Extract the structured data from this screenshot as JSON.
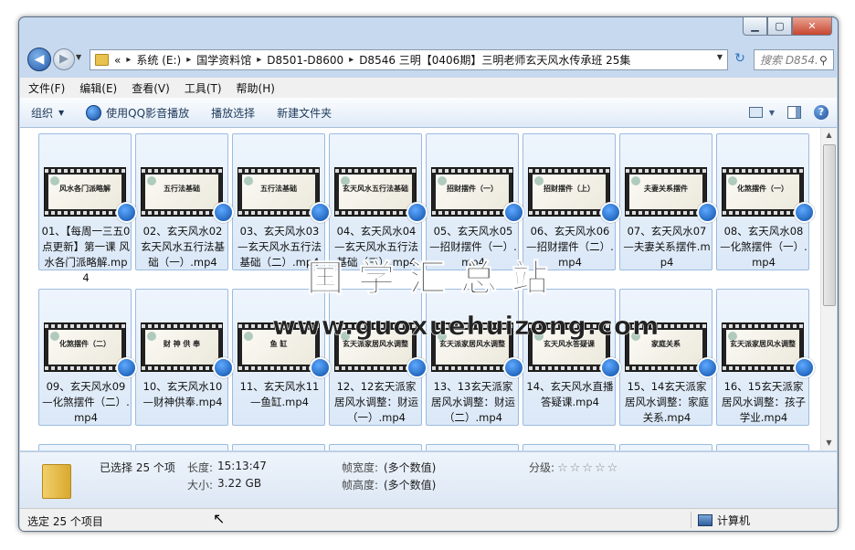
{
  "window": {
    "controls": {
      "minimize": "▁",
      "maximize": "▢",
      "close": "✕"
    }
  },
  "nav": {
    "address_parts": [
      "«",
      "系统 (E:)",
      "国学资料馆",
      "D8501-D8600",
      "D8546 三明【0406期】三明老师玄天风水传承班 25集"
    ],
    "search_placeholder": "搜索 D854...",
    "back_glyph": "◀",
    "forward_glyph": "▶",
    "refresh_glyph": "↻",
    "search_glyph": "⚲"
  },
  "menubar": {
    "items": [
      "文件(F)",
      "编辑(E)",
      "查看(V)",
      "工具(T)",
      "帮助(H)"
    ]
  },
  "toolbar": {
    "organize": "组织",
    "qq_play": "使用QQ影音播放",
    "play_selection": "播放选择",
    "new_folder": "新建文件夹",
    "help_glyph": "?"
  },
  "files": [
    {
      "name": "01、【每周一三五0点更新】第一课 风水各门派略解.mp4",
      "slide": "风水各门派略解"
    },
    {
      "name": "02、玄天风水02玄天风水五行法基础（一）.mp4",
      "slide": "五行法基础"
    },
    {
      "name": "03、玄天风水03—玄天风水五行法基础（二）.mp4",
      "slide": "五行法基础"
    },
    {
      "name": "04、玄天风水04—玄天风水五行法基础（三）.mp4",
      "slide": "玄天风水五行法基础"
    },
    {
      "name": "05、玄天风水05—招财摆件（一）.mp4",
      "slide": "招财摆件（一）"
    },
    {
      "name": "06、玄天风水06—招财摆件（二）.mp4",
      "slide": "招财摆件（上）"
    },
    {
      "name": "07、玄天风水07—夫妻关系摆件.mp4",
      "slide": "夫妻关系摆件"
    },
    {
      "name": "08、玄天风水08—化煞摆件（一）.mp4",
      "slide": "化煞摆件（一）"
    },
    {
      "name": "09、玄天风水09—化煞摆件（二）.mp4",
      "slide": "化煞摆件（二）"
    },
    {
      "name": "10、玄天风水10—财神供奉.mp4",
      "slide": "财 神 供 奉"
    },
    {
      "name": "11、玄天风水11—鱼缸.mp4",
      "slide": "鱼 缸"
    },
    {
      "name": "12、12玄天派家居风水调整：财运（一）.mp4",
      "slide": "玄天派家居风水调整"
    },
    {
      "name": "13、13玄天派家居风水调整：财运（二）.mp4",
      "slide": "玄天派家居风水调整"
    },
    {
      "name": "14、玄天风水直播答疑课.mp4",
      "slide": "玄天风水答疑课"
    },
    {
      "name": "15、14玄天派家居风水调整：家庭关系.mp4",
      "slide": "家庭关系"
    },
    {
      "name": "16、15玄天派家居风水调整：孩子学业.mp4",
      "slide": "玄天派家居风水调整"
    }
  ],
  "watermark": {
    "big": "国学汇总站",
    "url": "www.guoxuehuizong.com"
  },
  "details": {
    "selected_count": "已选择 25 个项",
    "length_label": "长度:",
    "length_value": "15:13:47",
    "size_label": "大小:",
    "size_value": "3.22 GB",
    "frame_width_label": "帧宽度:",
    "frame_width_value": "(多个数值)",
    "frame_height_label": "帧高度:",
    "frame_height_value": "(多个数值)",
    "rating_label": "分级:",
    "rating_stars": "☆☆☆☆☆"
  },
  "status": {
    "left": "选定 25 个项目",
    "right": "计算机"
  }
}
